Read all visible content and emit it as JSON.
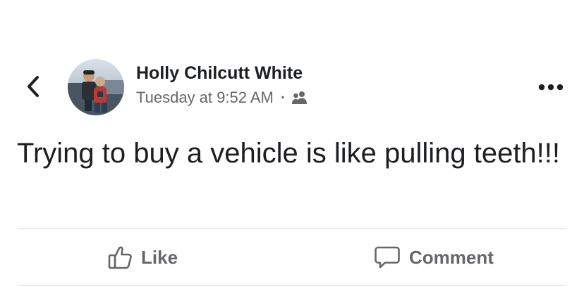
{
  "post": {
    "author_name": "Holly Chilcutt White",
    "timestamp": "Tuesday at 9:52 AM",
    "separator": "·",
    "audience_icon": "friends-icon",
    "text": "Trying to buy a vehicle is like pulling teeth!!!"
  },
  "header": {
    "back_icon": "chevron-left-icon",
    "more_icon": "more-horizontal-icon"
  },
  "actions": {
    "like_label": "Like",
    "like_icon": "thumbs-up-icon",
    "comment_label": "Comment",
    "comment_icon": "comment-icon"
  },
  "colors": {
    "text_primary": "#1c1e21",
    "text_secondary": "#65676b",
    "divider": "#d6d8db"
  }
}
